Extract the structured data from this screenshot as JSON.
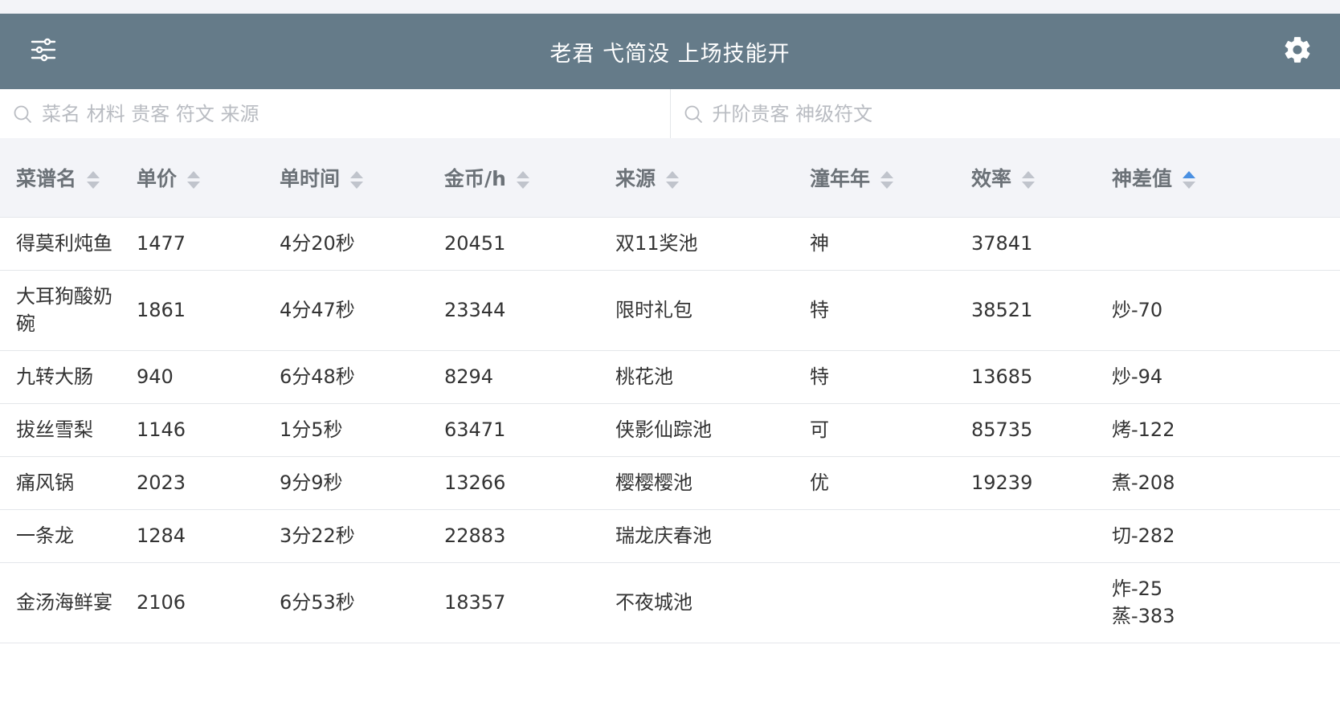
{
  "header": {
    "title": "老君 弋简没 上场技能开",
    "filter_icon": "filter-sliders-icon",
    "settings_icon": "gear-icon"
  },
  "search": {
    "left_placeholder": "菜名 材料 贵客 符文 来源",
    "right_placeholder": "升阶贵客 神级符文"
  },
  "colors": {
    "header_bg": "#657b89",
    "sort_active": "#4a90e2",
    "sort_inactive": "#c0c4cc"
  },
  "table": {
    "columns": [
      {
        "label": "菜谱名",
        "sort": "none"
      },
      {
        "label": "单价",
        "sort": "none"
      },
      {
        "label": "单时间",
        "sort": "none"
      },
      {
        "label": "金币/h",
        "sort": "none"
      },
      {
        "label": "来源",
        "sort": "none"
      },
      {
        "label": "潼年年",
        "sort": "none"
      },
      {
        "label": "效率",
        "sort": "none"
      },
      {
        "label": "神差值",
        "sort": "ascending"
      }
    ],
    "rows": [
      {
        "name": "得莫利炖鱼",
        "price": "1477",
        "time": "4分20秒",
        "gold": "20451",
        "source": "双11奖池",
        "rank": "神",
        "eff": "37841",
        "diff": [
          ""
        ]
      },
      {
        "name": "大耳狗酸奶碗",
        "price": "1861",
        "time": "4分47秒",
        "gold": "23344",
        "source": "限时礼包",
        "rank": "特",
        "eff": "38521",
        "diff": [
          "炒-70"
        ]
      },
      {
        "name": "九转大肠",
        "price": "940",
        "time": "6分48秒",
        "gold": "8294",
        "source": "桃花池",
        "rank": "特",
        "eff": "13685",
        "diff": [
          "炒-94"
        ]
      },
      {
        "name": "拔丝雪梨",
        "price": "1146",
        "time": "1分5秒",
        "gold": "63471",
        "source": "侠影仙踪池",
        "rank": "可",
        "eff": "85735",
        "diff": [
          "烤-122"
        ]
      },
      {
        "name": "痛风锅",
        "price": "2023",
        "time": "9分9秒",
        "gold": "13266",
        "source": "樱樱樱池",
        "rank": "优",
        "eff": "19239",
        "diff": [
          "煮-208"
        ]
      },
      {
        "name": "一条龙",
        "price": "1284",
        "time": "3分22秒",
        "gold": "22883",
        "source": "瑞龙庆春池",
        "rank": "",
        "eff": "",
        "diff": [
          "切-282"
        ]
      },
      {
        "name": "金汤海鲜宴",
        "price": "2106",
        "time": "6分53秒",
        "gold": "18357",
        "source": "不夜城池",
        "rank": "",
        "eff": "",
        "diff": [
          "炸-25",
          "蒸-383"
        ]
      }
    ]
  }
}
